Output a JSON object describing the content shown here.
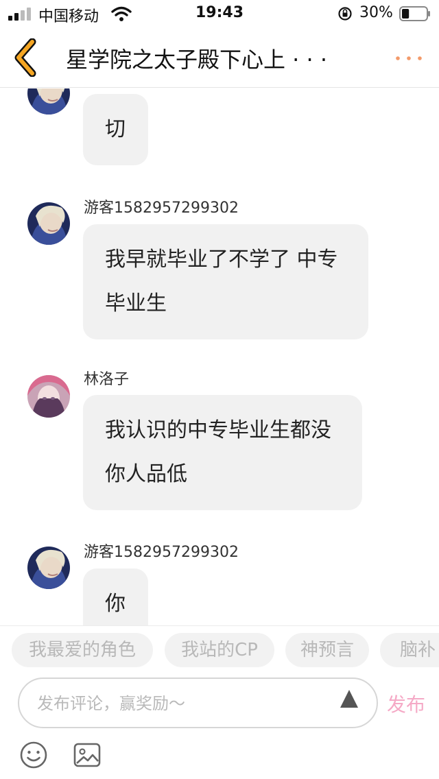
{
  "status_bar": {
    "carrier": "中国移动",
    "time": "19:43",
    "battery_percent": "30%",
    "battery_level": 0.3,
    "icons": [
      "signal-icon",
      "wifi-icon",
      "rotation-lock-icon",
      "battery-icon"
    ]
  },
  "nav": {
    "title": "星学院之太子殿下心上 · · ·",
    "back_icon": "back-chevron-icon",
    "more_icon": "more-dots-icon",
    "accent_color": "#f5a623",
    "more_color": "#f39a6a"
  },
  "messages": [
    {
      "username": "",
      "text": "切",
      "avatar": "blonde-avatar"
    },
    {
      "username": "游客1582957299302",
      "text": "我早就毕业了不学了 中专毕业生",
      "avatar": "blonde-avatar"
    },
    {
      "username": "林洛子",
      "text": "我认识的中专毕业生都没你人品低",
      "avatar": "pink-avatar"
    },
    {
      "username": "游客1582957299302",
      "text": "你",
      "avatar": "blonde-avatar"
    }
  ],
  "tags": [
    "我最爱的角色",
    "我站的CP",
    "神预言",
    "脑补"
  ],
  "composer": {
    "placeholder": "发布评论，赢奖励～",
    "publish_label": "发布",
    "publish_color": "#f5a9c6"
  },
  "toolbar": {
    "icons": [
      "emoji-icon",
      "image-icon"
    ]
  }
}
